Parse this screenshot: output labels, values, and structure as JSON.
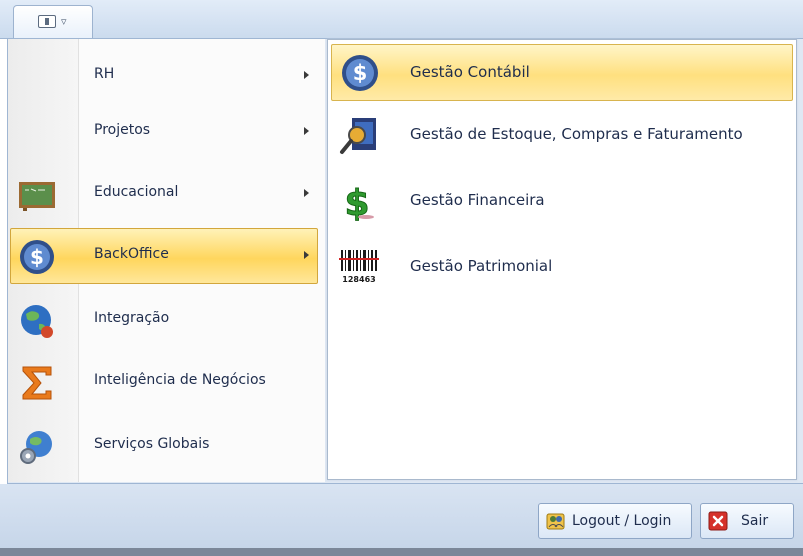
{
  "app_menu": {
    "button_icon": "application-menu-icon"
  },
  "left_menu": {
    "items": [
      {
        "label": "RH",
        "icon": "blank-icon",
        "has_submenu": true,
        "selected": false
      },
      {
        "label": "Projetos",
        "icon": "blank-icon",
        "has_submenu": true,
        "selected": false
      },
      {
        "label": "Educacional",
        "icon": "chalkboard-icon",
        "has_submenu": true,
        "selected": false
      },
      {
        "label": "BackOffice",
        "icon": "dollar-coin-icon",
        "has_submenu": true,
        "selected": true
      },
      {
        "label": "Integração",
        "icon": "globe-icon",
        "has_submenu": false,
        "selected": false
      },
      {
        "label": "Inteligência de Negócios",
        "icon": "sigma-icon",
        "has_submenu": false,
        "selected": false
      },
      {
        "label": "Serviços Globais",
        "icon": "globe-gears-icon",
        "has_submenu": false,
        "selected": false
      }
    ]
  },
  "submenu": {
    "items": [
      {
        "label": "Gestão Contábil",
        "icon": "dollar-coin-icon",
        "selected": true
      },
      {
        "label": "Gestão de Estoque, Compras e Faturamento",
        "icon": "inventory-search-icon",
        "selected": false
      },
      {
        "label": "Gestão Financeira",
        "icon": "green-dollar-icon",
        "selected": false
      },
      {
        "label": "Gestão Patrimonial",
        "icon": "barcode-icon",
        "selected": false,
        "icon_text": "128463"
      }
    ]
  },
  "footer": {
    "logout_label": "Logout / Login",
    "exit_label": "Sair"
  },
  "colors": {
    "selection": "#ffd65d",
    "frame": "#dfe8f3",
    "text": "#1f2d4d"
  }
}
